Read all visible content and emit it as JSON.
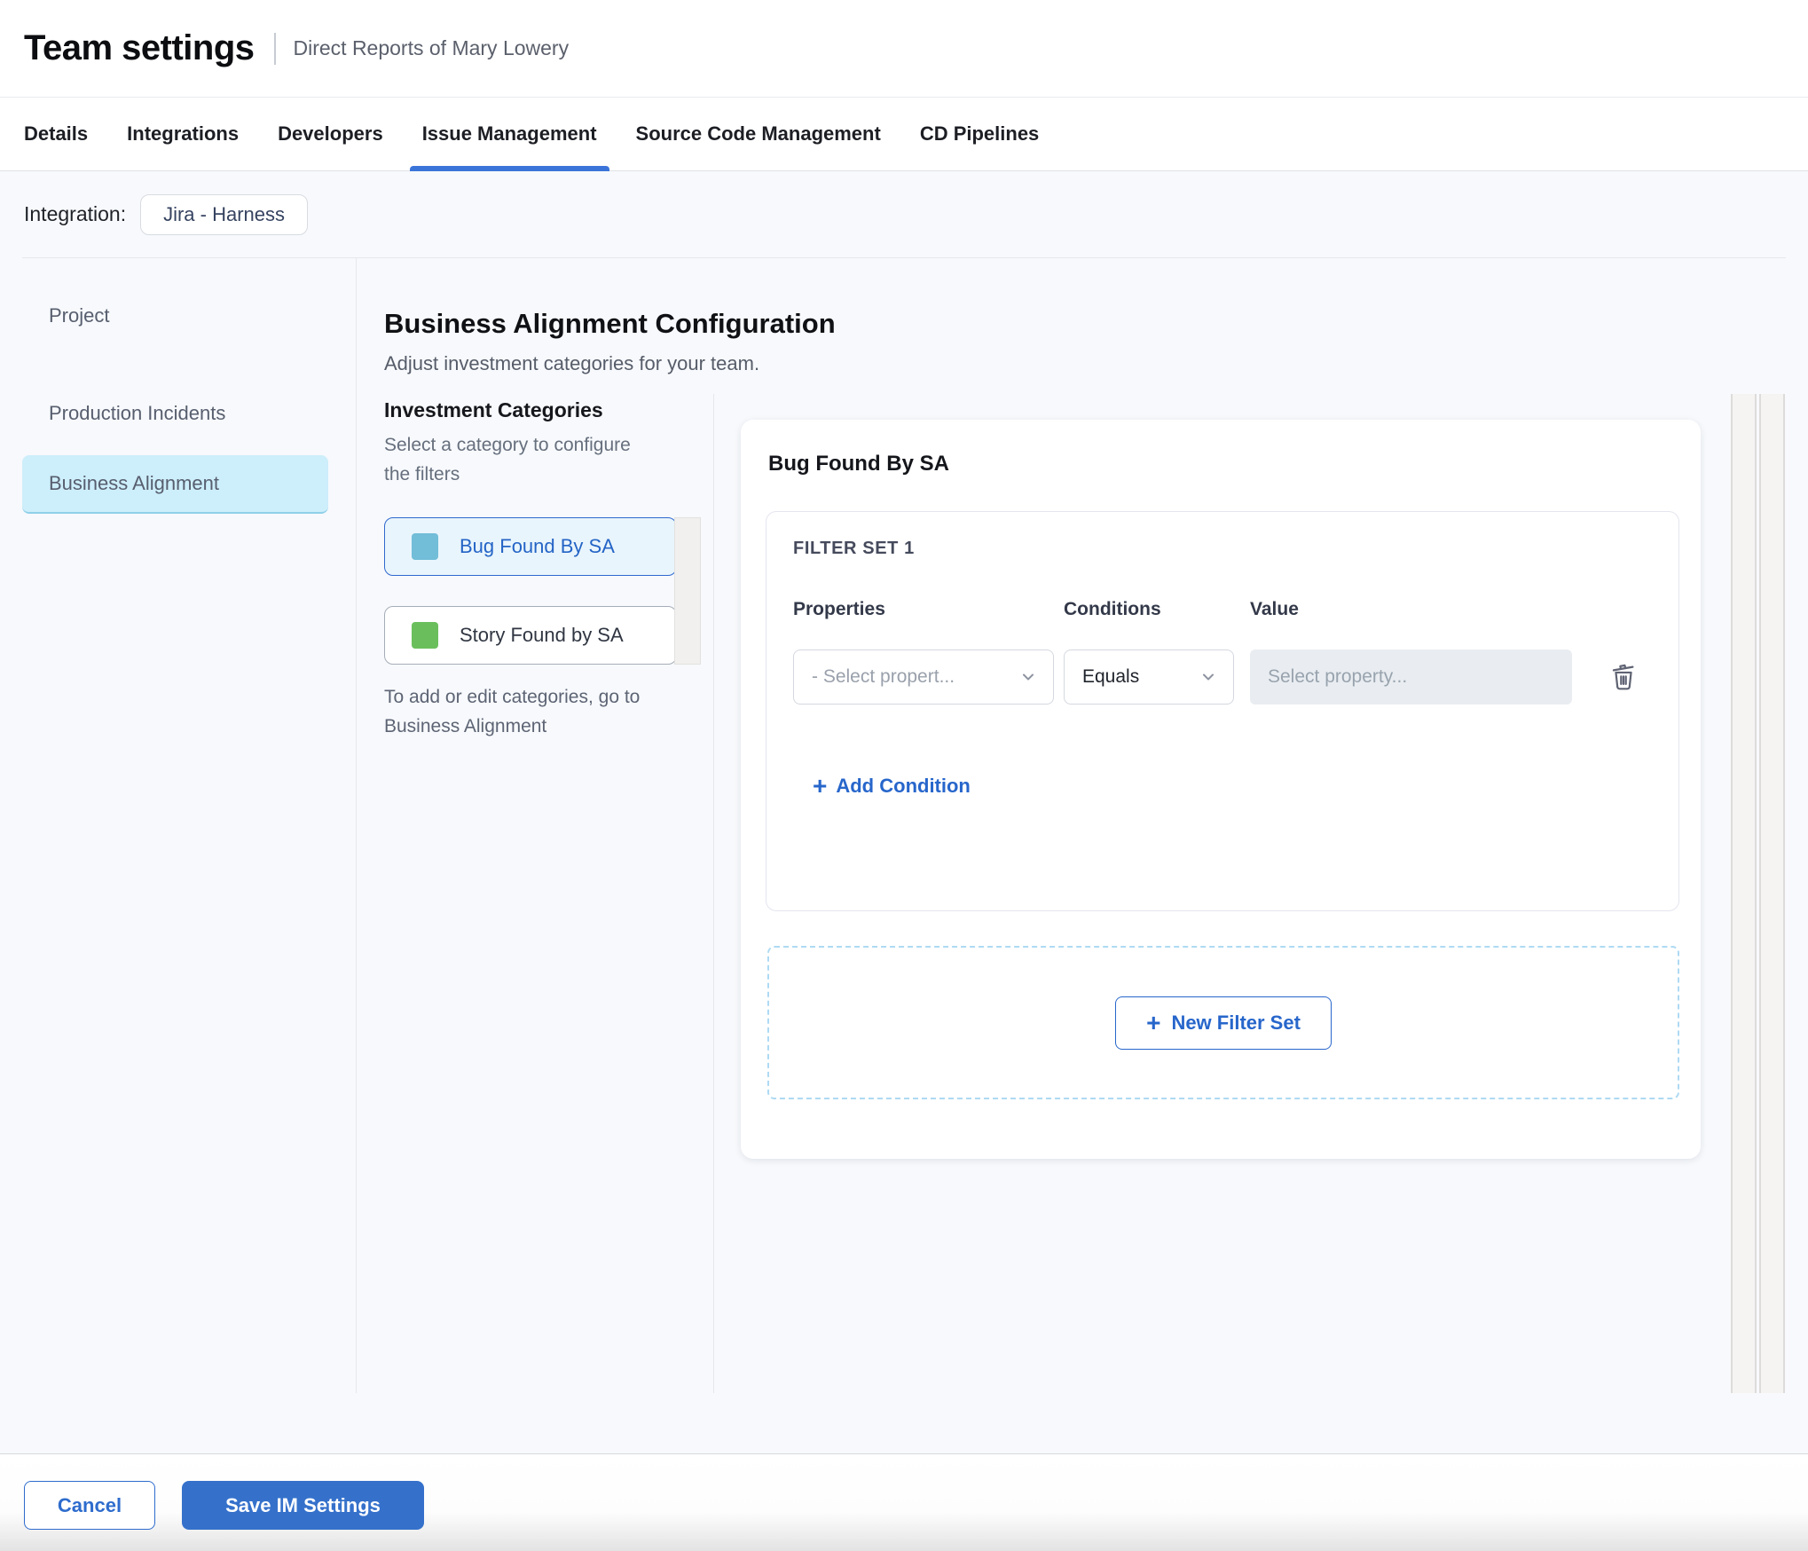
{
  "header": {
    "title": "Team settings",
    "subtitle": "Direct Reports of Mary Lowery"
  },
  "tabs": [
    {
      "label": "Details",
      "active": false
    },
    {
      "label": "Integrations",
      "active": false
    },
    {
      "label": "Developers",
      "active": false
    },
    {
      "label": "Issue Management",
      "active": true
    },
    {
      "label": "Source Code Management",
      "active": false
    },
    {
      "label": "CD Pipelines",
      "active": false
    }
  ],
  "integration": {
    "label": "Integration:",
    "chip": "Jira - Harness"
  },
  "sidebar": {
    "items": [
      {
        "label": "Project",
        "selected": false
      },
      {
        "label": "Production Incidents",
        "selected": false
      },
      {
        "label": "Business Alignment",
        "selected": true
      }
    ]
  },
  "main": {
    "title": "Business Alignment Configuration",
    "subtitle": "Adjust investment categories for your team.",
    "categories": {
      "heading": "Investment Categories",
      "hint": "Select a category to configure the filters",
      "items": [
        {
          "label": "Bug Found By SA",
          "swatch": "#72bdd8",
          "selected": true
        },
        {
          "label": "Story Found by SA",
          "swatch": "#6abf5c",
          "selected": false
        }
      ],
      "footnote": "To add or edit categories, go to Business Alignment"
    },
    "panel": {
      "heading": "Bug Found By SA",
      "filter_set": {
        "label": "FILTER SET 1",
        "columns": {
          "properties": "Properties",
          "conditions": "Conditions",
          "value": "Value"
        },
        "property_placeholder": "- Select propert...",
        "condition_value": "Equals",
        "value_placeholder": "Select property...",
        "add_condition_label": "Add Condition"
      },
      "new_filter_set_label": "New Filter Set"
    }
  },
  "footer": {
    "cancel_label": "Cancel",
    "save_label": "Save IM Settings"
  },
  "colors": {
    "accent_blue": "#2e6ccd",
    "active_tab_underline": "#3b74d9",
    "selected_sidebar_bg": "#cdeefb",
    "selected_category_bg": "#e9f5fc",
    "save_button_bg": "#3571cb",
    "bug_swatch": "#72bdd8",
    "story_swatch": "#6abf5c"
  }
}
